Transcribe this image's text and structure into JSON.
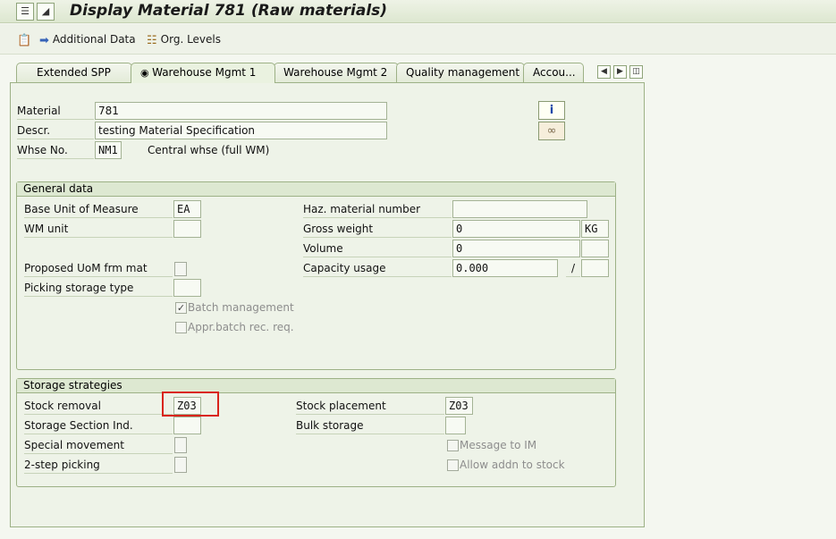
{
  "window": {
    "title": "Display Material 781 (Raw materials)"
  },
  "toolbar": {
    "additional_data": "Additional Data",
    "org_levels": "Org. Levels"
  },
  "tabs": {
    "items": [
      "Extended SPP",
      "Warehouse Mgmt 1",
      "Warehouse Mgmt 2",
      "Quality management",
      "Accou..."
    ],
    "active": "Warehouse Mgmt 1"
  },
  "header": {
    "material_label": "Material",
    "material_value": "781",
    "descr_label": "Descr.",
    "descr_value": "testing Material Specification",
    "whse_label": "Whse No.",
    "whse_value": "NM1",
    "whse_text": "Central whse (full WM)"
  },
  "general": {
    "title": "General data",
    "base_uom_label": "Base Unit of Measure",
    "base_uom_value": "EA",
    "wm_unit_label": "WM unit",
    "wm_unit_value": "",
    "proposed_uom_label": "Proposed UoM frm mat",
    "picking_storage_label": "Picking storage type",
    "batch_mgmt_label": "Batch management",
    "batch_mgmt_checked": true,
    "appr_batch_label": "Appr.batch rec. req.",
    "appr_batch_checked": false,
    "haz_label": "Haz. material number",
    "haz_value": "",
    "gross_weight_label": "Gross weight",
    "gross_weight_value": "0",
    "gross_weight_unit": "KG",
    "volume_label": "Volume",
    "volume_value": "0",
    "capacity_label": "Capacity usage",
    "capacity_value": "0.000",
    "capacity_sep": "/"
  },
  "storage": {
    "title": "Storage strategies",
    "stock_removal_label": "Stock removal",
    "stock_removal_value": "Z03",
    "section_ind_label": "Storage Section Ind.",
    "special_mvmt_label": "Special movement",
    "two_step_label": "2-step picking",
    "stock_placement_label": "Stock placement",
    "stock_placement_value": "Z03",
    "bulk_storage_label": "Bulk storage",
    "message_im_label": "Message to IM",
    "allow_addn_label": "Allow addn to stock"
  },
  "colors": {
    "highlight": "#d9241b",
    "panel_bg": "#eef3e8",
    "border": "#9db186"
  }
}
